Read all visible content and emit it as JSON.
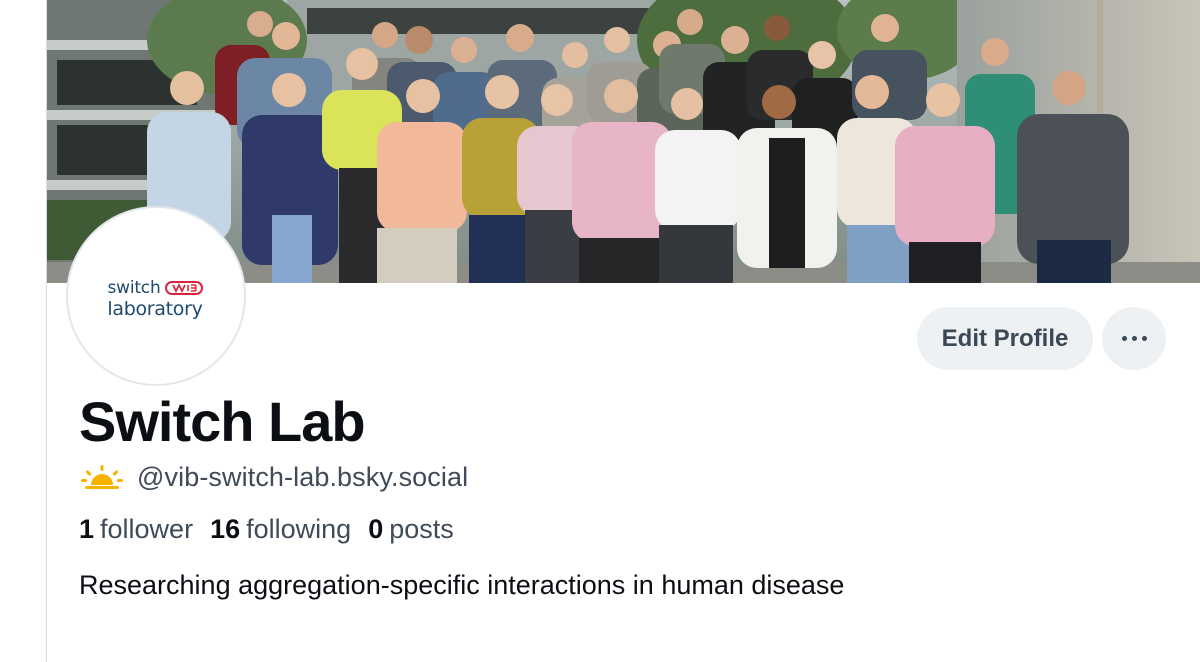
{
  "profile": {
    "display_name": "Switch Lab",
    "handle": "@vib-switch-lab.bsky.social",
    "bio": "Researching aggregation-specific interactions in human disease",
    "banner_icon": "team-group-photo",
    "handle_badge_icon": "sun-icon",
    "avatar_logo": {
      "line1": "switch",
      "line2": "laboratory",
      "icon": "vib-logo-icon"
    },
    "stats": [
      {
        "count": "1",
        "label": "follower"
      },
      {
        "count": "16",
        "label": "following"
      },
      {
        "count": "0",
        "label": "posts"
      }
    ]
  },
  "actions": {
    "edit_profile_label": "Edit Profile",
    "more_icon": "ellipsis-icon"
  },
  "colors": {
    "text_primary": "#0b0f14",
    "text_secondary": "#3f4b58",
    "button_bg": "#eef1f4",
    "logo_blue": "#1d4a6d",
    "logo_red": "#d7263d",
    "badge_yellow": "#f6b400"
  }
}
